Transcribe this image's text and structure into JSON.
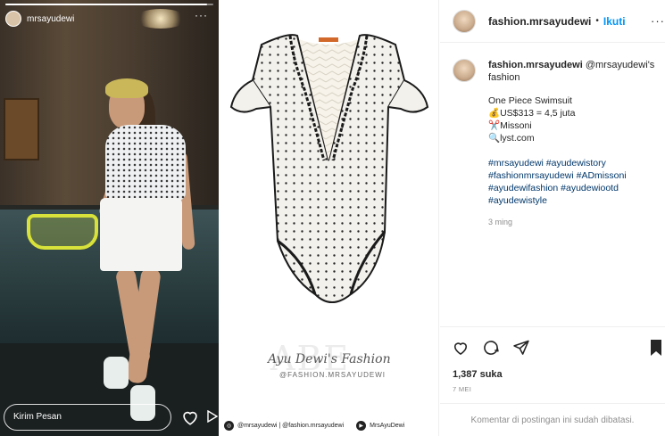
{
  "story": {
    "username": "mrsayudewi",
    "progress": 0.97,
    "more_label": "···",
    "reply_placeholder": "Kirim Pesan"
  },
  "product": {
    "watermark_bg": "ABE",
    "watermark_name": "Ayu Dewi's Fashion",
    "watermark_handle": "@FASHION.MRSAYUDEWI",
    "credits": [
      "@mrsayudewi | @fashion.mrsayudewi",
      "MrsAyuDewi"
    ]
  },
  "post": {
    "header": {
      "username": "fashion.mrsayudewi",
      "dot": "•",
      "follow_label": "Ikuti",
      "more_label": "···"
    },
    "caption": {
      "username": "fashion.mrsayudewi",
      "mention": "@mrsayudewi",
      "suffix": "'s fashion",
      "item": "One Piece Swimsuit",
      "price": "💰US$313 = 4,5 juta",
      "brand": "✂️Missoni",
      "shop": "🔍lyst.com",
      "hashtags": "#mrsayudewi #ayudewistory #fashionmrsayudewi #ADmissoni #ayudewifashion #ayudewiootd #ayudewistyle",
      "time": "3 ming"
    },
    "likes": "1,387 suka",
    "date": "7 MEI",
    "comments_off": "Komentar di postingan ini sudah dibatasi."
  },
  "colors": {
    "link_blue": "#0095f6",
    "hashtag": "#00376b",
    "muted": "#8e8e8e"
  },
  "icons": [
    "heart-icon",
    "comment-icon",
    "share-icon",
    "bookmark-icon",
    "more-icon",
    "instagram-icon",
    "youtube-icon"
  ]
}
